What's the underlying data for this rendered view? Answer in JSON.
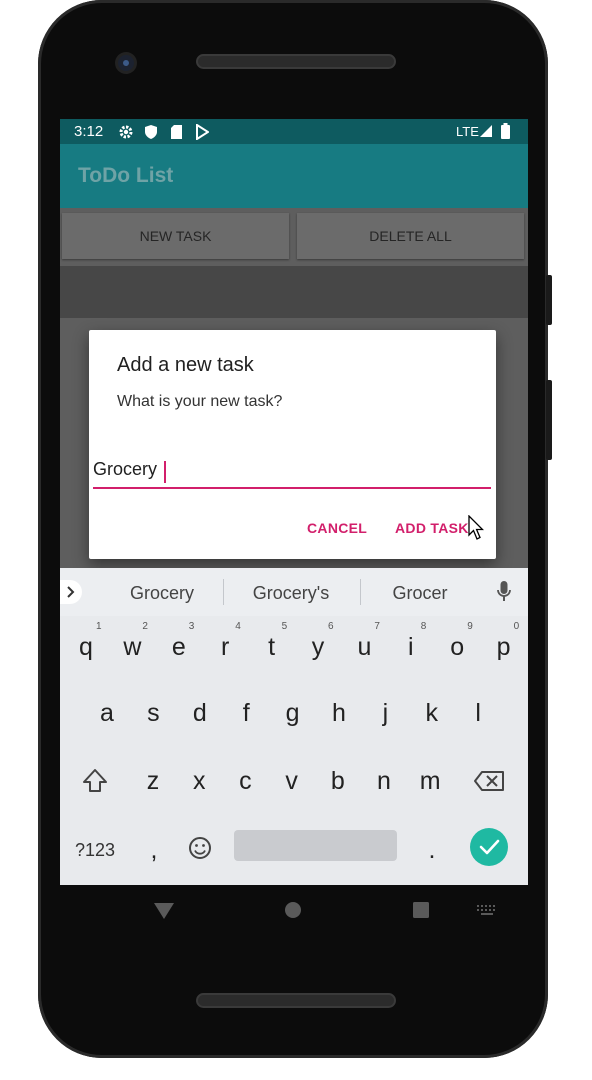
{
  "status_bar": {
    "time": "3:12",
    "network": "LTE",
    "icons": [
      "gear-icon",
      "shield-icon",
      "sd-card-icon",
      "play-store-icon",
      "signal-icon",
      "battery-icon"
    ]
  },
  "app_bar": {
    "title": "ToDo List"
  },
  "buttons": {
    "new_task": "NEW TASK",
    "delete_all": "DELETE ALL"
  },
  "dialog": {
    "title": "Add a new task",
    "message": "What is your new task?",
    "input_value": "Grocery",
    "cancel_label": "CANCEL",
    "add_label": "ADD TASK"
  },
  "keyboard": {
    "suggestions": [
      "Grocery",
      "Grocery's",
      "Grocer"
    ],
    "row1": [
      {
        "key": "q",
        "hint": "1"
      },
      {
        "key": "w",
        "hint": "2"
      },
      {
        "key": "e",
        "hint": "3"
      },
      {
        "key": "r",
        "hint": "4"
      },
      {
        "key": "t",
        "hint": "5"
      },
      {
        "key": "y",
        "hint": "6"
      },
      {
        "key": "u",
        "hint": "7"
      },
      {
        "key": "i",
        "hint": "8"
      },
      {
        "key": "o",
        "hint": "9"
      },
      {
        "key": "p",
        "hint": "0"
      }
    ],
    "row2": [
      "a",
      "s",
      "d",
      "f",
      "g",
      "h",
      "j",
      "k",
      "l"
    ],
    "row3": [
      "z",
      "x",
      "c",
      "v",
      "b",
      "n",
      "m"
    ],
    "symbols_label": "?123",
    "comma": ",",
    "period": "."
  },
  "colors": {
    "accent": "#d21f6b",
    "app_bar": "#177b82",
    "status_bar": "#0e5b60",
    "enter_key": "#1fb9a2"
  }
}
